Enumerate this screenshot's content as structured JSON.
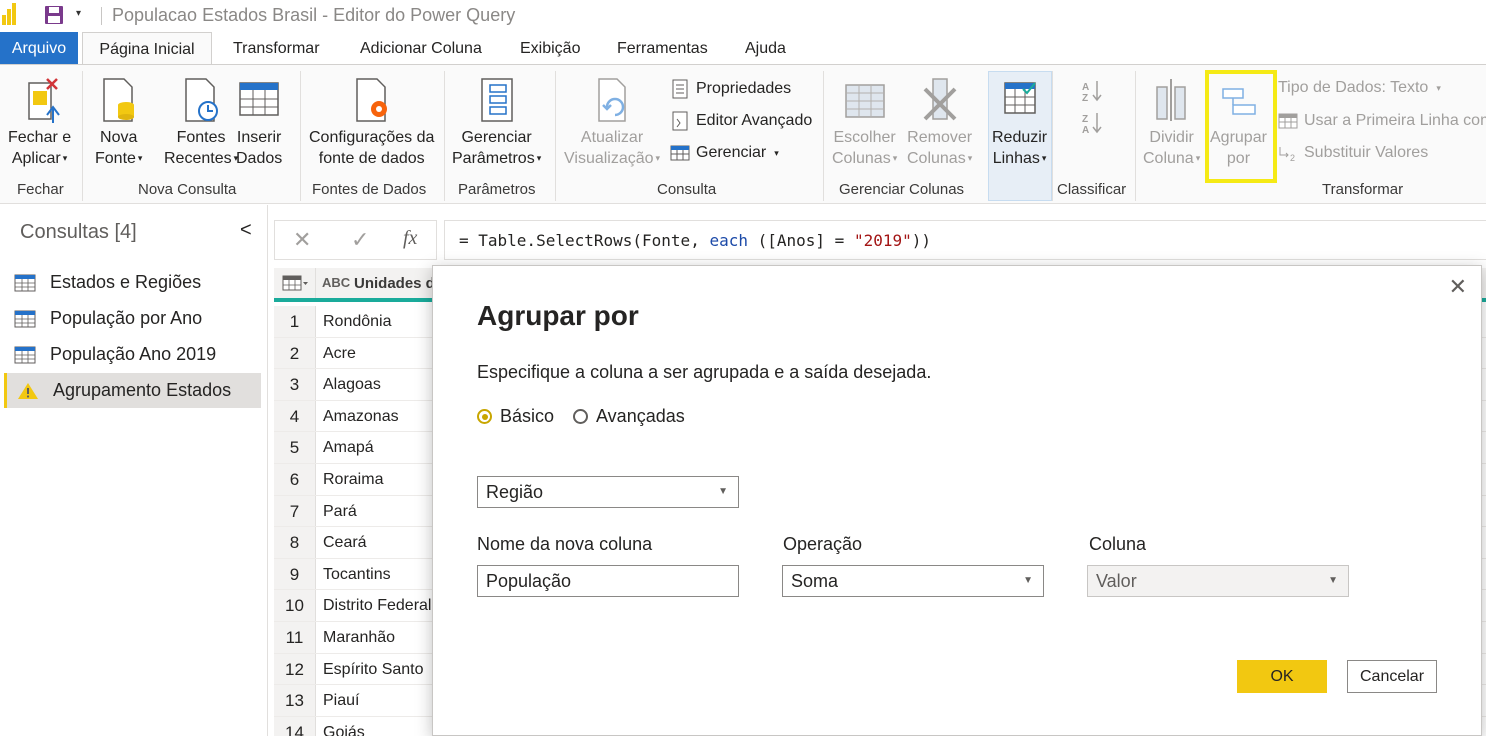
{
  "window": {
    "title": "Populacao Estados Brasil - Editor do Power Query",
    "quick_access_dropdown": "▾"
  },
  "ribbon_tabs": {
    "file": "Arquivo",
    "active": "Página Inicial",
    "items": [
      "Transformar",
      "Adicionar Coluna",
      "Exibição",
      "Ferramentas",
      "Ajuda"
    ]
  },
  "ribbon": {
    "close": {
      "button": [
        "Fechar e",
        "Aplicar"
      ],
      "group": "Fechar"
    },
    "new_query": {
      "buttons": [
        [
          "Nova",
          "Fonte"
        ],
        [
          "Fontes",
          "Recentes"
        ],
        [
          "Inserir",
          "Dados"
        ]
      ],
      "group": "Nova Consulta"
    },
    "data_sources": {
      "button": [
        "Configurações da",
        "fonte de dados"
      ],
      "group": "Fontes de Dados"
    },
    "parameters": {
      "button": [
        "Gerenciar",
        "Parâmetros"
      ],
      "group": "Parâmetros"
    },
    "query": {
      "refresh": [
        "Atualizar",
        "Visualização"
      ],
      "properties": "Propriedades",
      "advanced_editor": "Editor Avançado",
      "manage": "Gerenciar",
      "group": "Consulta"
    },
    "manage_columns": {
      "choose": [
        "Escolher",
        "Colunas"
      ],
      "remove": [
        "Remover",
        "Colunas"
      ],
      "group": "Gerenciar Colunas"
    },
    "reduce": {
      "button": [
        "Reduzir",
        "Linhas"
      ]
    },
    "sort": {
      "group": "Classificar"
    },
    "transform": {
      "split": [
        "Dividir",
        "Coluna"
      ],
      "group_by": [
        "Agrupar",
        "por"
      ],
      "data_type": "Tipo de Dados: Texto",
      "first_row": "Usar a Primeira Linha com",
      "replace": "Substituir Valores",
      "group": "Transformar"
    },
    "caret": "▾"
  },
  "queries": {
    "title": "Consultas [4]",
    "collapse": "<",
    "items": [
      {
        "name": "Estados e Regiões"
      },
      {
        "name": "População por Ano"
      },
      {
        "name": "População Ano 2019"
      },
      {
        "name": "Agrupamento Estados"
      }
    ]
  },
  "formula_bar": {
    "cancel": "✕",
    "commit": "✓",
    "fx": "fx",
    "prefix": "= Table.SelectRows(Fonte, ",
    "keyword": "each",
    "middle": " ([Anos] = ",
    "string": "\"2019\"",
    "suffix": "))"
  },
  "grid": {
    "column_type": "ABC",
    "column_name": "Unidades da Federação",
    "rows": [
      {
        "n": "1",
        "value": "Rondônia"
      },
      {
        "n": "2",
        "value": "Acre"
      },
      {
        "n": "3",
        "value": "Alagoas"
      },
      {
        "n": "4",
        "value": "Amazonas"
      },
      {
        "n": "5",
        "value": "Amapá"
      },
      {
        "n": "6",
        "value": "Roraima"
      },
      {
        "n": "7",
        "value": "Pará"
      },
      {
        "n": "8",
        "value": "Ceará"
      },
      {
        "n": "9",
        "value": "Tocantins"
      },
      {
        "n": "10",
        "value": "Distrito Federal"
      },
      {
        "n": "11",
        "value": "Maranhão"
      },
      {
        "n": "12",
        "value": "Espírito Santo"
      },
      {
        "n": "13",
        "value": "Piauí"
      },
      {
        "n": "14",
        "value": "Goiás"
      }
    ]
  },
  "dialog": {
    "title": "Agrupar por",
    "subtitle": "Especifique a coluna a ser agrupada e a saída desejada.",
    "mode_basic": "Básico",
    "mode_advanced": "Avançadas",
    "group_column": "Região",
    "new_column_label": "Nome da nova coluna",
    "new_column_value": "População",
    "operation_label": "Operação",
    "operation_value": "Soma",
    "column_label": "Coluna",
    "column_value": "Valor",
    "ok": "OK",
    "cancel": "Cancelar",
    "close": "✕"
  },
  "colors": {
    "accent": "#f2c811",
    "file_tab": "#2572c9",
    "highlight": "#f5ea15",
    "column_quality": "#1aab9b"
  }
}
